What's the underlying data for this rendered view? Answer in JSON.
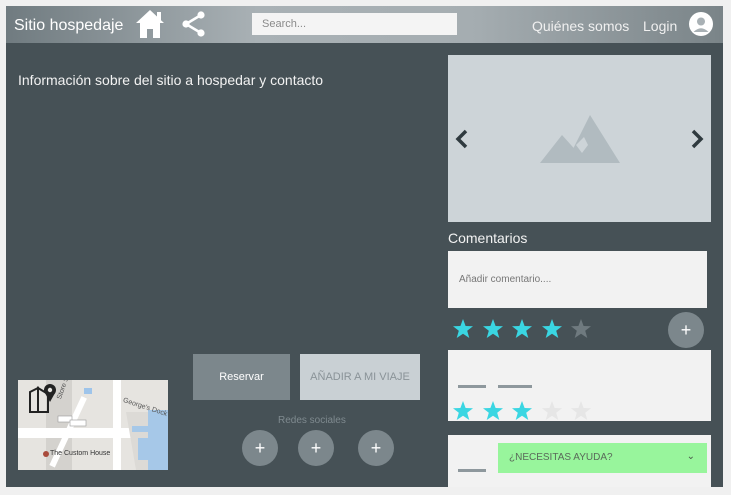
{
  "header": {
    "brand": "Sitio hospedaje",
    "search_placeholder": "Search...",
    "nav_about": "Quiénes somos",
    "nav_login": "Login"
  },
  "main": {
    "info_text": "Información sobre del sitio a hospedar y contacto",
    "reservar_label": "Reservar",
    "anadir_label": "AÑADIR A MI VIAJE",
    "social_label": "Redes sociales",
    "social_buttons": [
      "+",
      "+",
      "+"
    ]
  },
  "map": {
    "place_label": "The Custom House",
    "street_label_1": "George's Dock",
    "street_label_2": "Store St"
  },
  "comments": {
    "title": "Comentarios",
    "input_placeholder": "Añadir comentario....",
    "add_button": "+",
    "rating_input": 4,
    "reviews": [
      {
        "rating": 3
      },
      {
        "rating": 0
      }
    ],
    "star_max": 5
  },
  "help": {
    "label": "¿NECESITAS AYUDA?",
    "chevron": "⌄"
  },
  "colors": {
    "star_filled": "#3ad6e2",
    "star_empty_dark": "#6f7a7f",
    "star_empty_light": "#e6e6e6",
    "help_bg": "#98f59c"
  }
}
